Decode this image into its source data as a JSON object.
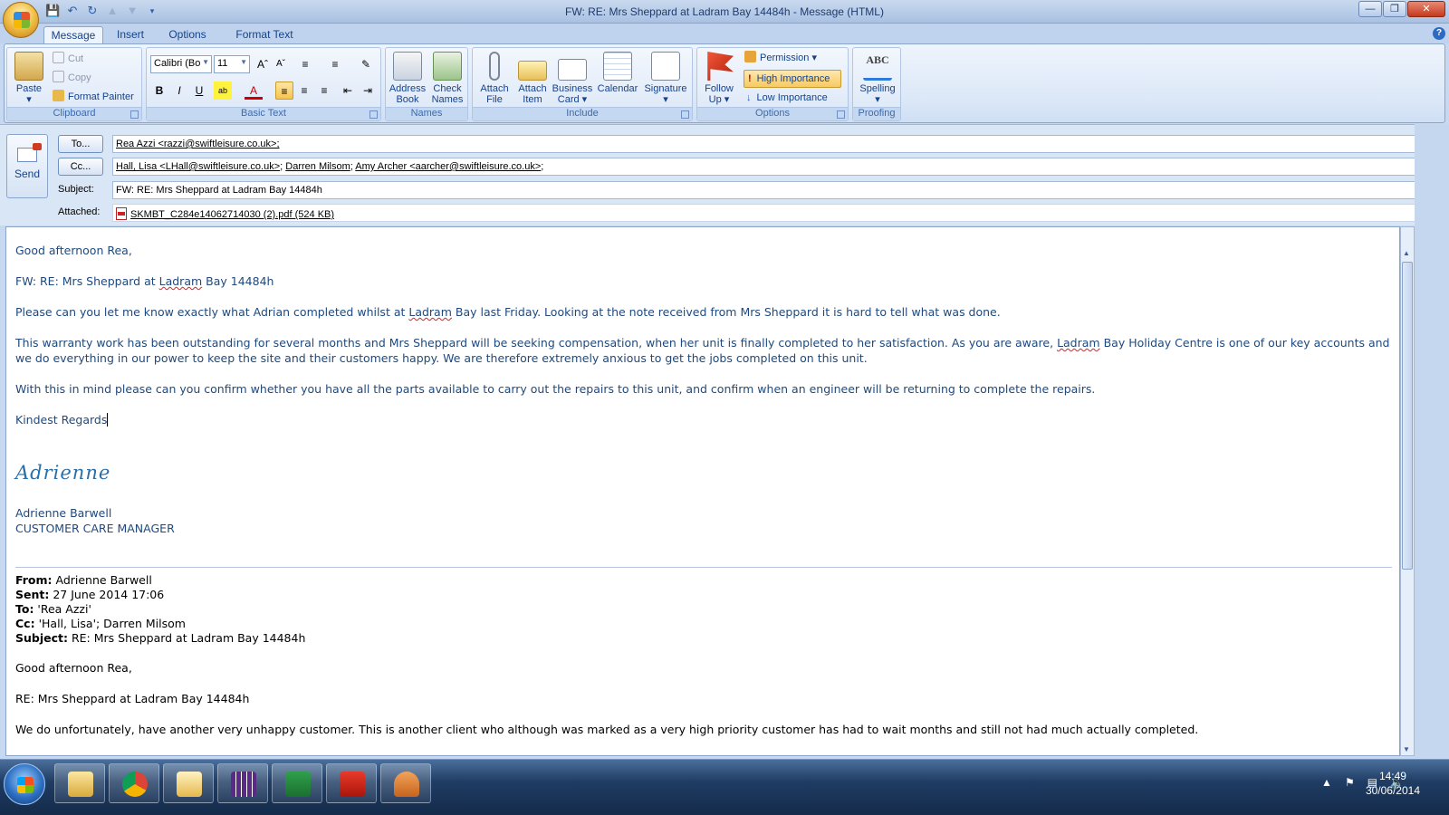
{
  "window": {
    "title": "FW: RE: Mrs Sheppard at Ladram Bay 14484h  - Message (HTML)"
  },
  "tabs": [
    "Message",
    "Insert",
    "Options",
    "Format Text"
  ],
  "ribbon": {
    "clipboard": {
      "label": "Clipboard",
      "paste": "Paste",
      "cut": "Cut",
      "copy": "Copy",
      "format_painter": "Format Painter"
    },
    "basic_text": {
      "label": "Basic Text",
      "font_name": "Calibri (Bo",
      "font_size": "11"
    },
    "names": {
      "label": "Names",
      "address_book": "Address Book",
      "check_names": "Check Names"
    },
    "include": {
      "label": "Include",
      "attach_file": "Attach File",
      "attach_item": "Attach Item",
      "business_card": "Business Card",
      "calendar": "Calendar",
      "signature": "Signature"
    },
    "options": {
      "label": "Options",
      "follow_up": "Follow Up",
      "permission": "Permission",
      "high_importance": "High Importance",
      "low_importance": "Low Importance"
    },
    "proofing": {
      "label": "Proofing",
      "spelling": "Spelling"
    }
  },
  "header": {
    "send": "Send",
    "to_button": "To...",
    "cc_button": "Cc...",
    "subject_label": "Subject:",
    "attached_label": "Attached:",
    "to": "Rea Azzi <razzi@swiftleisure.co.uk>;",
    "cc": [
      "Hall, Lisa <LHall@swiftleisure.co.uk>",
      "Darren Milsom",
      "Amy Archer <aarcher@swiftleisure.co.uk>"
    ],
    "subject": "FW: RE: Mrs Sheppard at Ladram Bay 14484h",
    "attachment": "SKMBT_C284e14062714030 (2).pdf (524 KB)"
  },
  "body": {
    "greeting": "Good afternoon Rea,",
    "subject_line": {
      "pre": "FW: RE: Mrs Sheppard at ",
      "word": "Ladram",
      "post": " Bay 14484h"
    },
    "p1": {
      "pre": "Please can you let me know exactly what Adrian completed whilst at ",
      "word": "Ladram",
      "post": " Bay last Friday.  Looking at the note received from Mrs Sheppard it is hard to tell what was done."
    },
    "p2": {
      "pre": "This warranty work has been outstanding for several months and Mrs Sheppard will be seeking compensation, when her unit is finally completed to her satisfaction.  As you are aware, ",
      "word": "Ladram",
      "post": " Bay Holiday Centre is one of our key accounts and we do everything in our power to keep the site and their customers happy.  We are therefore extremely anxious to get the jobs completed on this unit."
    },
    "p3": "With this in mind please can you confirm whether you have all the parts available to carry out the repairs to this unit, and confirm when an engineer will be returning to complete the repairs.",
    "closing": "Kindest Regards",
    "signature_script": "Adrienne",
    "signature_name": "Adrienne Barwell",
    "signature_title": "CUSTOMER CARE MANAGER"
  },
  "original": {
    "from_label": "From:",
    "from": " Adrienne Barwell",
    "sent_label": "Sent:",
    "sent": " 27 June 2014 17:06",
    "to_label": "To:",
    "to": " 'Rea Azzi'",
    "cc_label": "Cc:",
    "cc": " 'Hall, Lisa'; Darren Milsom",
    "subject_label": "Subject:",
    "subject": " RE: Mrs Sheppard at Ladram Bay 14484h",
    "greeting": "Good afternoon Rea,",
    "subject_line": "RE: Mrs Sheppard at Ladram Bay 14484h",
    "p1": "We do unfortunately, have another very unhappy customer.  This is another client  who although was marked as a very high priority customer has had to wait months and still not had much actually completed."
  },
  "taskbar": {
    "time": "14:49",
    "date": "30/06/2014"
  }
}
